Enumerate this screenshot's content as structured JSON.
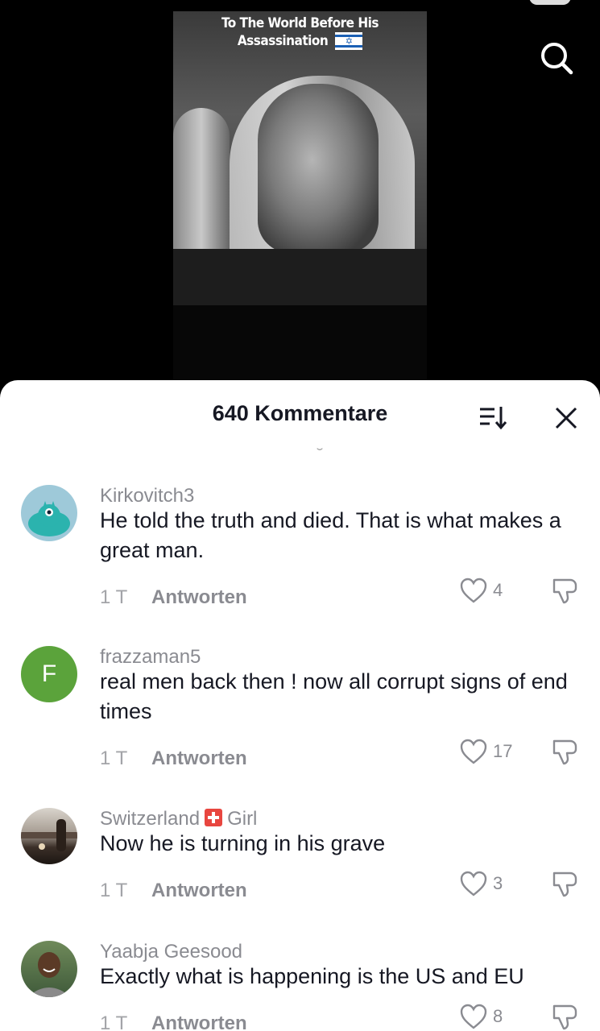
{
  "video": {
    "caption_line1": "To The World Before His",
    "caption_line2": "Assassination",
    "flag_symbol": "✡"
  },
  "sheet": {
    "title": "640 Kommentare"
  },
  "colors": {
    "sheet_bg": "#ffffff",
    "text_primary": "#161823",
    "text_secondary": "#8a8b91",
    "avatar_f_bg": "#5ba33b",
    "avatar_mascot_bg": "#9ec9d9",
    "swiss_flag": "#e8463f"
  },
  "comments": [
    {
      "username": "Kirkovitch3",
      "text": "He told the truth and died. That is what makes a great man.",
      "time": "1 T",
      "reply": "Antworten",
      "likes": "4",
      "avatar": "mascot"
    },
    {
      "username": "frazzaman5",
      "text": "real men back then ! now all corrupt signs of end times",
      "time": "1 T",
      "reply": "Antworten",
      "likes": "17",
      "avatar": "letter",
      "avatar_letter": "F"
    },
    {
      "username_a": "Switzerland",
      "username_b": "Girl",
      "text": "Now he is turning in his grave",
      "time": "1 T",
      "reply": "Antworten",
      "likes": "3",
      "avatar": "photo-landscape"
    },
    {
      "username": "Yaabja Geesood",
      "text": "Exactly what is happening is the US and EU",
      "time": "1 T",
      "reply": "Antworten",
      "likes": "8",
      "avatar": "photo-person"
    }
  ]
}
